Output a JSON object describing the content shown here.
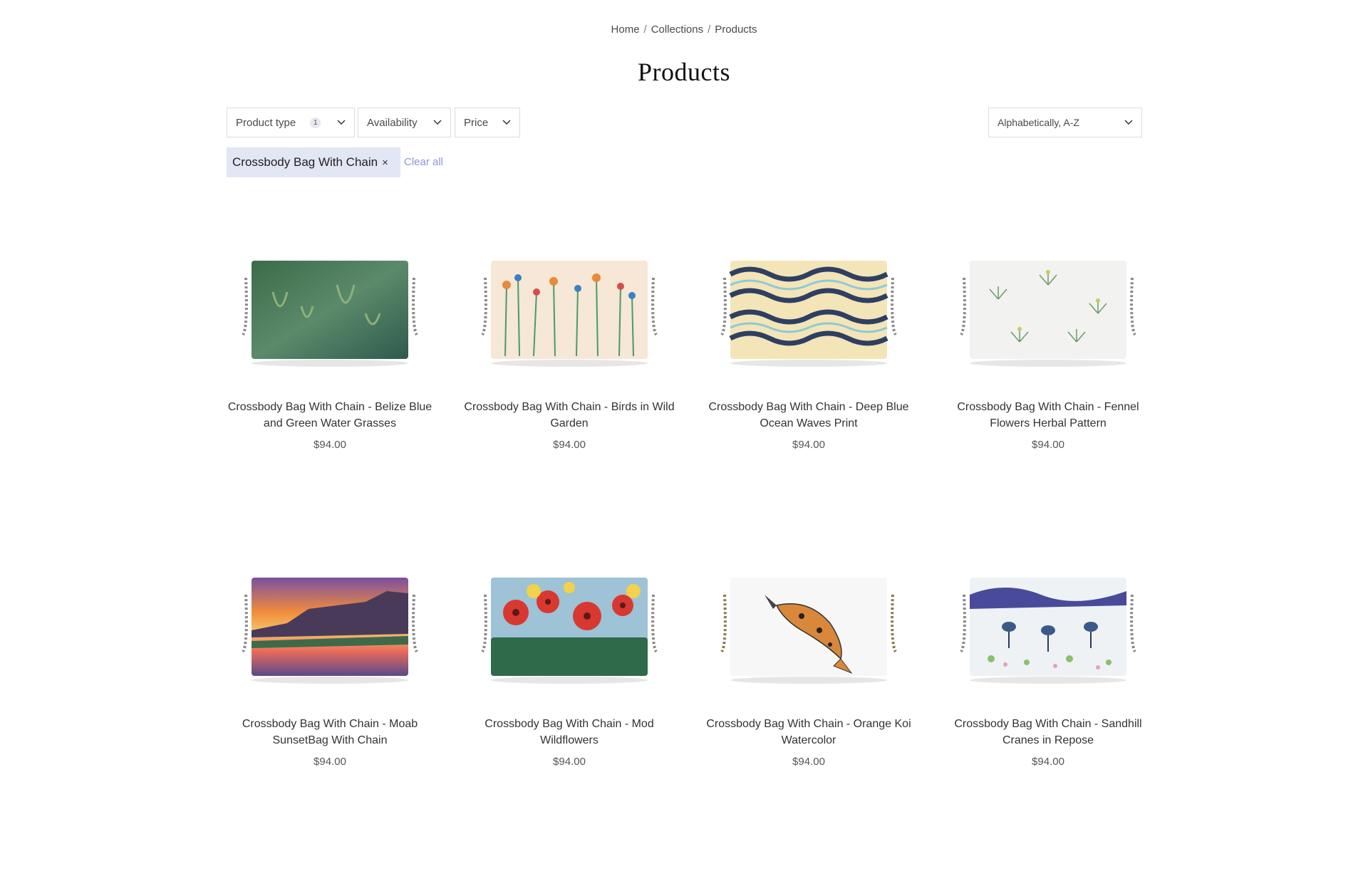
{
  "breadcrumb": {
    "home": "Home",
    "collections": "Collections",
    "products": "Products",
    "separator": "/"
  },
  "page_title": "Products",
  "filters": {
    "product_type": {
      "label": "Product type",
      "count": "1"
    },
    "availability": {
      "label": "Availability"
    },
    "price": {
      "label": "Price"
    },
    "sort": {
      "selected": "Alphabetically, A-Z"
    }
  },
  "active_filter": {
    "label": "Crossbody Bag With Chain",
    "remove_icon": "×"
  },
  "clear_all": "Clear all",
  "products": [
    {
      "name": "Crossbody Bag With Chain - Belize Blue and Green Water Grasses",
      "price": "$94.00"
    },
    {
      "name": "Crossbody Bag With Chain - Birds in Wild Garden",
      "price": "$94.00"
    },
    {
      "name": "Crossbody Bag With Chain - Deep Blue Ocean Waves Print",
      "price": "$94.00"
    },
    {
      "name": "Crossbody Bag With Chain - Fennel Flowers Herbal Pattern",
      "price": "$94.00"
    },
    {
      "name": "Crossbody Bag With Chain - Moab SunsetBag With Chain",
      "price": "$94.00"
    },
    {
      "name": "Crossbody Bag With Chain - Mod Wildflowers",
      "price": "$94.00"
    },
    {
      "name": "Crossbody Bag With Chain - Orange Koi Watercolor",
      "price": "$94.00"
    },
    {
      "name": "Crossbody Bag With Chain - Sandhill Cranes in Repose",
      "price": "$94.00"
    }
  ],
  "colors": {
    "chip_bg": "#e3e6f4",
    "link_accent": "#8a97d4",
    "border": "#dcdcdc"
  }
}
